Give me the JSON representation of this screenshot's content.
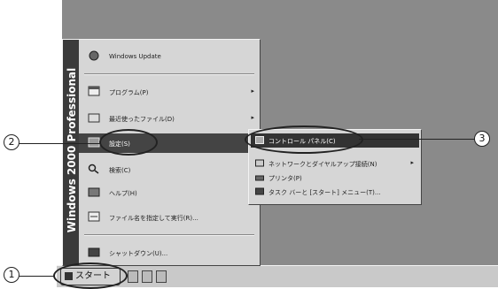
{
  "taskbar": {
    "start_label": "スタート"
  },
  "start_menu": {
    "banner": "Windows 2000 Professional",
    "items": [
      {
        "label": "Windows Update",
        "icon": "globe-icon"
      },
      {
        "label": "プログラム(P)",
        "icon": "programs-icon"
      },
      {
        "label": "最近使ったファイル(D)",
        "icon": "documents-icon"
      },
      {
        "label": "設定(S)",
        "icon": "settings-icon"
      },
      {
        "label": "検索(C)",
        "icon": "search-icon"
      },
      {
        "label": "ヘルプ(H)",
        "icon": "help-icon"
      },
      {
        "label": "ファイル名を指定して実行(R)...",
        "icon": "run-icon"
      },
      {
        "label": "シャットダウン(U)...",
        "icon": "shutdown-icon"
      }
    ]
  },
  "settings_submenu": {
    "items": [
      {
        "label": "コントロール パネル(C)",
        "icon": "control-panel-icon"
      },
      {
        "label": "ネットワークとダイヤルアップ接続(N)",
        "icon": "network-icon"
      },
      {
        "label": "プリンタ(P)",
        "icon": "printer-icon"
      },
      {
        "label": "タスク バーと [スタート] メニュー(T)...",
        "icon": "taskbar-icon"
      }
    ]
  },
  "callouts": [
    "1",
    "2",
    "3"
  ]
}
